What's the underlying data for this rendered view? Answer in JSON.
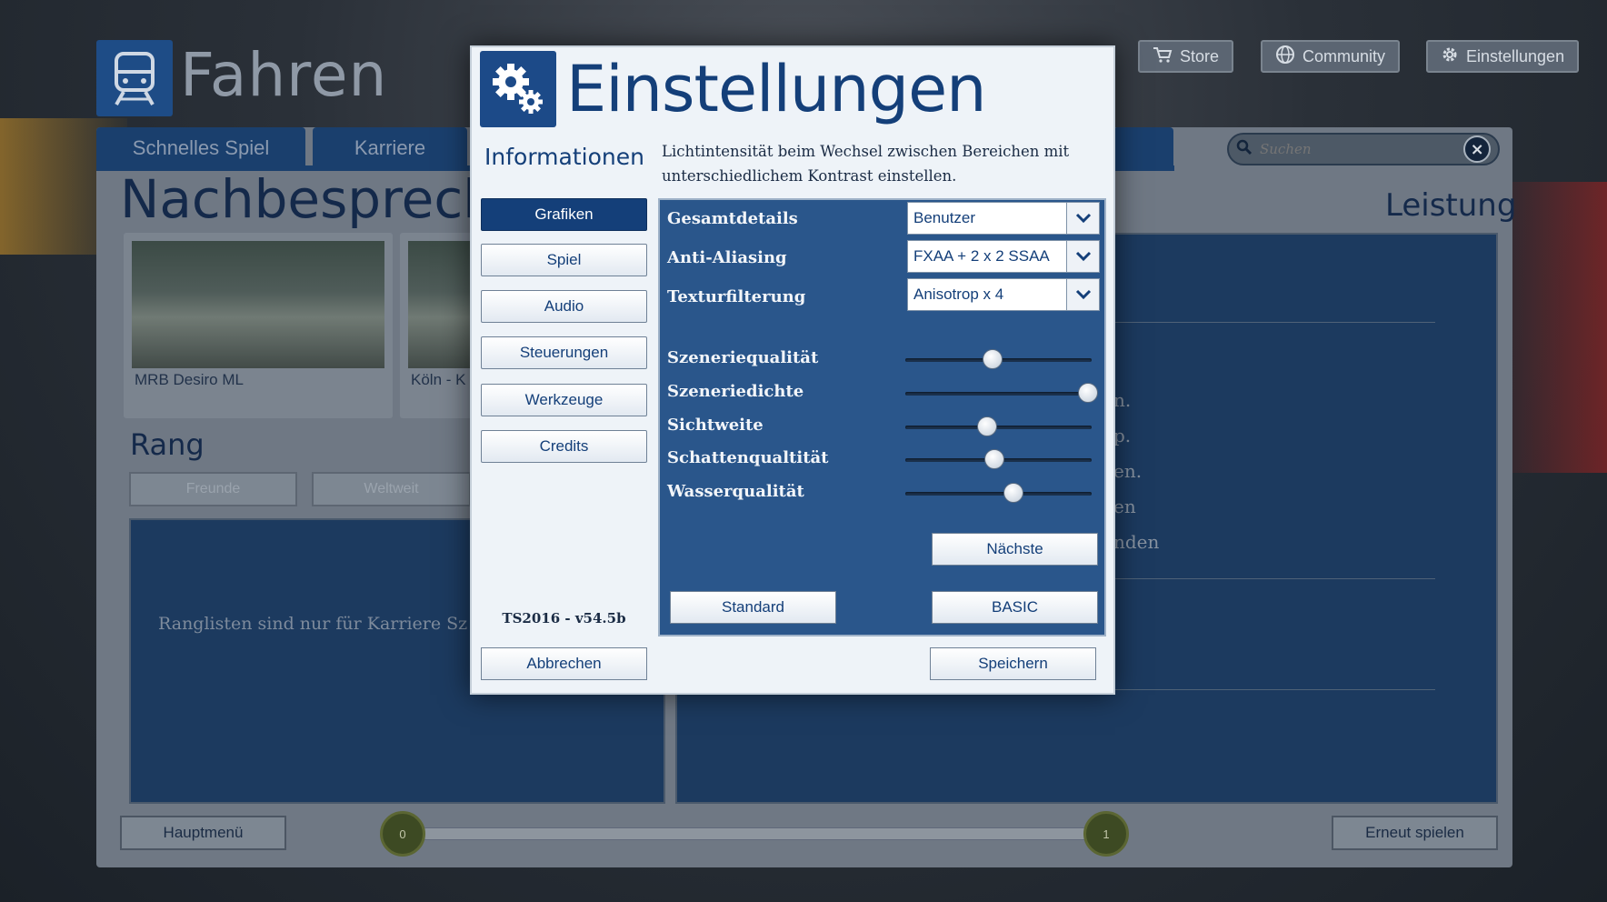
{
  "app": {
    "heading": "Fahren",
    "top_buttons": {
      "store": "Store",
      "community": "Community",
      "settings": "Einstellungen"
    },
    "tabs": [
      "Schnelles Spiel",
      "Karriere"
    ],
    "page_title": "Nachbesprech",
    "right_heading": "Leistung",
    "search": {
      "placeholder": "Suchen"
    },
    "cards": [
      {
        "caption": "MRB Desiro ML"
      },
      {
        "caption": "Köln - K"
      }
    ],
    "rank": {
      "title": "Rang",
      "buttons": [
        "Freunde",
        "Weltweit"
      ],
      "message": "Ranglisten sind nur für Karriere Sz"
    },
    "right_fragments": [
      "n.",
      "p.",
      "en.",
      "en",
      "nden"
    ],
    "bottom": {
      "main_menu": "Hauptmenü",
      "replay": "Erneut spielen",
      "progress_start": "0",
      "progress_end": "1"
    }
  },
  "modal": {
    "title": "Einstellungen",
    "info_heading": "Informationen",
    "description": "Lichtintensität beim Wechsel zwischen Bereichen mit unterschiedlichem Kontrast einstellen.",
    "nav": [
      "Grafiken",
      "Spiel",
      "Audio",
      "Steuerungen",
      "Werkzeuge",
      "Credits"
    ],
    "active_nav": "Grafiken",
    "version": "TS2016 - v54.5b",
    "dropdowns": [
      {
        "label": "Gesamtdetails",
        "value": "Benutzer"
      },
      {
        "label": "Anti-Aliasing",
        "value": "FXAA + 2 x 2 SSAA"
      },
      {
        "label": "Texturfilterung",
        "value": "Anisotrop x 4"
      }
    ],
    "sliders": [
      {
        "label": "Szeneriequalität",
        "level": 0.47
      },
      {
        "label": "Szeneriedichte",
        "level": 0.98
      },
      {
        "label": "Sichtweite",
        "level": 0.44
      },
      {
        "label": "Schattenqualtität",
        "level": 0.48
      },
      {
        "label": "Wasserqualität",
        "level": 0.58
      }
    ],
    "buttons": {
      "next": "Nächste",
      "default": "Standard",
      "basic": "BASIC",
      "cancel": "Abbrechen",
      "save": "Speichern"
    }
  },
  "colors": {
    "accent": "#143f79",
    "panel": "#2a568b",
    "modal_bg": "#eef3f8"
  }
}
